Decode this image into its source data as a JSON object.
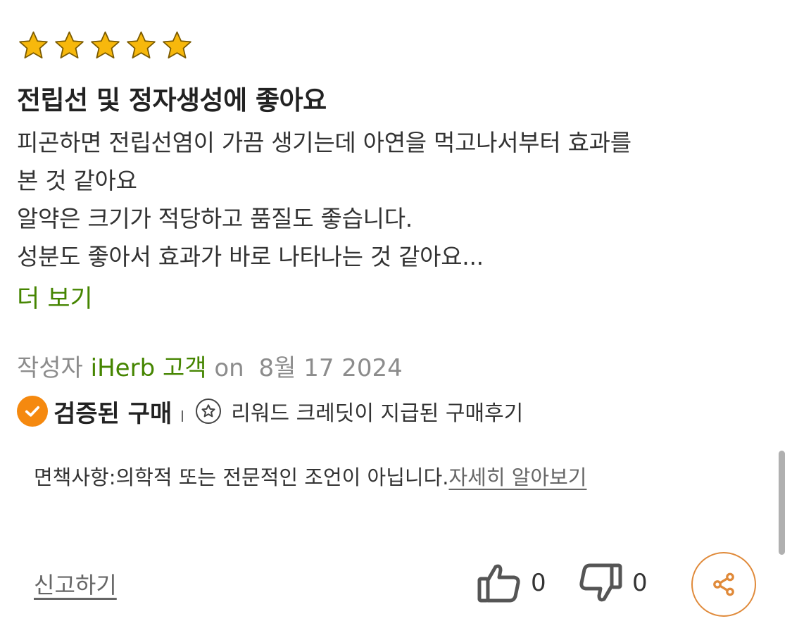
{
  "review": {
    "rating": 5,
    "rating_max": 5,
    "title": "전립선 및 정자생성에 좋아요",
    "body_lines": [
      "피곤하면 전립선염이 가끔 생기는데 아연을 먹고나서부터 효과를",
      "본 것 같아요",
      "알약은 크기가 적당하고 품질도 좋습니다.",
      "성분도 좋아서 효과가 바로 나타나는 것 같아요..."
    ],
    "more_label": "더 보기",
    "meta": {
      "prefix": "작성자",
      "author": "iHerb 고객",
      "on": "on",
      "date": "8월 17 2024"
    },
    "badges": {
      "verified": "검증된 구매",
      "reward": "리워드 크레딧이 지급된 구매후기"
    },
    "disclaimer": {
      "text": "면책사항:의학적 또는 전문적인 조언이 아닙니다.",
      "link": "자세히 알아보기"
    },
    "actions": {
      "report": "신고하기",
      "helpful_count": "0",
      "unhelpful_count": "0"
    }
  },
  "icons": {
    "stars": "star-icon",
    "verified": "checkmark-icon",
    "reward": "star-circle-icon",
    "thumbs_up": "thumbs-up-icon",
    "thumbs_down": "thumbs-down-icon",
    "share": "share-icon"
  },
  "colors": {
    "star": "#f7b80c",
    "link_green": "#458500",
    "verified_orange": "#f5890f",
    "share_border": "#e08a3a"
  }
}
